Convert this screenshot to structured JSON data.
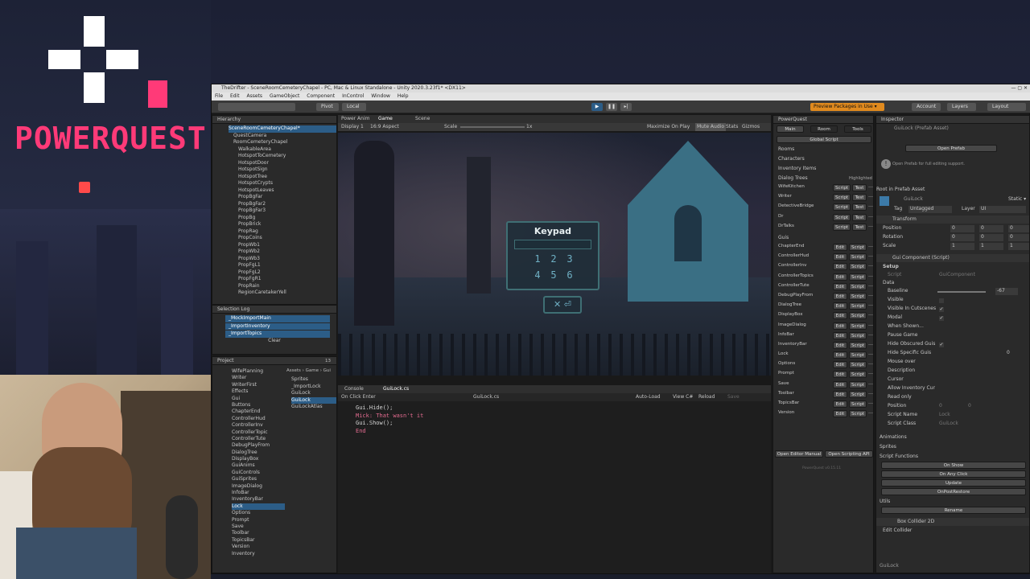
{
  "overlay": {
    "logo_text": "POWERQUEST"
  },
  "window": {
    "title": "TheDrifter - SceneRoomCemeteryChapel - PC, Mac & Linux Standalone - Unity 2020.3.23f1* <DX11>",
    "menu": [
      "File",
      "Edit",
      "Assets",
      "GameObject",
      "Component",
      "InControl",
      "Window",
      "Help"
    ]
  },
  "toolbar": {
    "pivot": "Pivot",
    "local": "Local",
    "preview_packages": "Preview Packages in Use ▾",
    "account": "Account",
    "layers": "Layers",
    "layout": "Layout"
  },
  "hierarchy": {
    "title": "Hierarchy",
    "items": [
      "SceneRoomCemeteryChapel*",
      "QuestCamera",
      "RoomCemeteryChapel",
      "WalkableArea",
      "HotspotToCemetery",
      "HotspotDoor",
      "HotspotSign",
      "HotspotTree",
      "HotspotCrypts",
      "HotspotLeaves",
      "PropBgFar",
      "PropBgFar2",
      "PropBgFar3",
      "PropBg",
      "PropBrick",
      "PropRag",
      "PropCoins",
      "PropWb1",
      "PropWb2",
      "PropWb3",
      "PropFgL1",
      "PropFgL2",
      "PropFgR1",
      "PropRain",
      "RegionCaretakerYell"
    ]
  },
  "selection_log": {
    "title": "Selection Log",
    "items": [
      "_MockImportMain",
      "_ImportInventory",
      "_ImportTopics"
    ],
    "clear": "Clear"
  },
  "project": {
    "title": "Project",
    "folders": [
      "WifePlanning",
      "Writer",
      "WriterFirst",
      "Effects",
      "Gui",
      "Buttons",
      "ChapterEnd",
      "ControllerHud",
      "ControllerInv",
      "ControllerTopic",
      "ControllerTute",
      "DebugPlayFrom",
      "DialogTree",
      "DisplayBox",
      "GuiAnims",
      "GuiControls",
      "GuiSprites",
      "ImageDialog",
      "InfoBar",
      "InventoryBar",
      "Lock",
      "Options",
      "Prompt",
      "Save",
      "Toolbar",
      "TopicsBar",
      "Version",
      "Inventory"
    ],
    "breadcrumb": "Assets › Game › Gui",
    "files": [
      "Sprites",
      "_ImportLock",
      "GuiLock",
      "GuiLock",
      "GuiLockAtlas"
    ],
    "count": "13"
  },
  "game_tabs": [
    "Power Anim",
    "Game",
    "Scene"
  ],
  "game_bar": {
    "display": "Display 1",
    "aspect": "16:9 Aspect",
    "scale_label": "Scale",
    "scale_value": "1x",
    "maximize": "Maximize On Play",
    "mute": "Mute Audio",
    "stats": "Stats",
    "gizmos": "Gizmos"
  },
  "keypad": {
    "title": "Keypad",
    "keys": [
      "1",
      "2",
      "3",
      "4",
      "5",
      "6"
    ]
  },
  "code_panel": {
    "tabs": [
      "Console",
      "GuiLock.cs"
    ],
    "event": "On Click Enter",
    "file": "GuiLock.cs",
    "auto_load": "Auto-Load",
    "view_cs": "View C#",
    "reload": "Reload",
    "save": "Save",
    "lines": [
      "Gui.Hide();",
      "Mick: That wasn't it",
      "Gui.Show();",
      "End"
    ]
  },
  "powerquest": {
    "title": "PowerQuest",
    "tabs": [
      "Main",
      "Room",
      "Tools"
    ],
    "global_script": "Global Script",
    "sections": [
      "Rooms",
      "Characters",
      "Inventory Items"
    ],
    "dialog_header": "Dialog Trees",
    "highlighted": "Highlighted",
    "dialogs": [
      "WifeKitchen",
      "Writer",
      "DetectiveBridge",
      "Dr",
      "DrTalks"
    ],
    "guis_header": "Guis",
    "guis": [
      "ChapterEnd",
      "ControllerHud",
      "ControllerInv",
      "ControllerTopics",
      "ControllerTute",
      "DebugPlayFrom",
      "DialogTree",
      "DisplayBox",
      "ImageDialog",
      "InfoBar",
      "InventoryBar",
      "Lock",
      "Options",
      "Prompt",
      "Save",
      "Toolbar",
      "TopicsBar",
      "Version"
    ],
    "script_btn": "Script",
    "test_btn": "Test",
    "edit_btn": "Edit",
    "open_editor_manual": "Open Editor Manual",
    "open_scripting": "Open Scripting API",
    "version": "PowerQuest v0.15.11"
  },
  "inspector": {
    "title": "Inspector",
    "object": "GuiLock (Prefab Asset)",
    "open_prefab": "Open Prefab",
    "prefab_note": "Open Prefab for full editing support.",
    "root_label": "Root in Prefab Asset",
    "name": "GuiLock",
    "static": "Static ▾",
    "tag_label": "Tag",
    "tag": "Untagged",
    "layer_label": "Layer",
    "layer": "UI",
    "transform": "Transform",
    "position": "Position",
    "rotation": "Rotation",
    "scale": "Scale",
    "pos": [
      "0",
      "0",
      "0"
    ],
    "rot": [
      "0",
      "0",
      "0"
    ],
    "scl": [
      "1",
      "1",
      "1"
    ],
    "gui_component": "Gui Component (Script)",
    "setup": "Setup",
    "script_label": "Script",
    "script_value": "GuiComponent",
    "data": "Data",
    "props": [
      "Baseline",
      "Visible",
      "Visible In Cutscenes",
      "Modal",
      "When Shown...",
      "Pause Game",
      "Hide Obscured Guis",
      "Hide Specific Guis",
      "Mouse over",
      "Description",
      "Cursor",
      "Allow Inventory Cur",
      "Read only",
      "Position",
      "Script Name",
      "Script Class"
    ],
    "baseline_value": "-67",
    "hide_specific_value": "0",
    "script_name_value": "Lock",
    "script_class_value": "GuiLock",
    "readonly_pos": [
      "0",
      "0"
    ],
    "animations": "Animations",
    "sprites": "Sprites",
    "script_functions": "Script Functions",
    "func_buttons": [
      "On Show",
      "On Any Click",
      "Update",
      "OnPostRestore"
    ],
    "utils": "Utils",
    "rename": "Rename",
    "box_collider": "Box Collider 2D",
    "edit_collider": "Edit Collider",
    "footer": "GuiLock"
  },
  "colors": {
    "logo_pink": "#ff3a78",
    "unity_select": "#2c5d87",
    "keypad_border": "#3f6f74",
    "keypad_text": "#6fb0c4",
    "code_pink": "#e26b8f",
    "code_yellow": "#e6c07b"
  }
}
